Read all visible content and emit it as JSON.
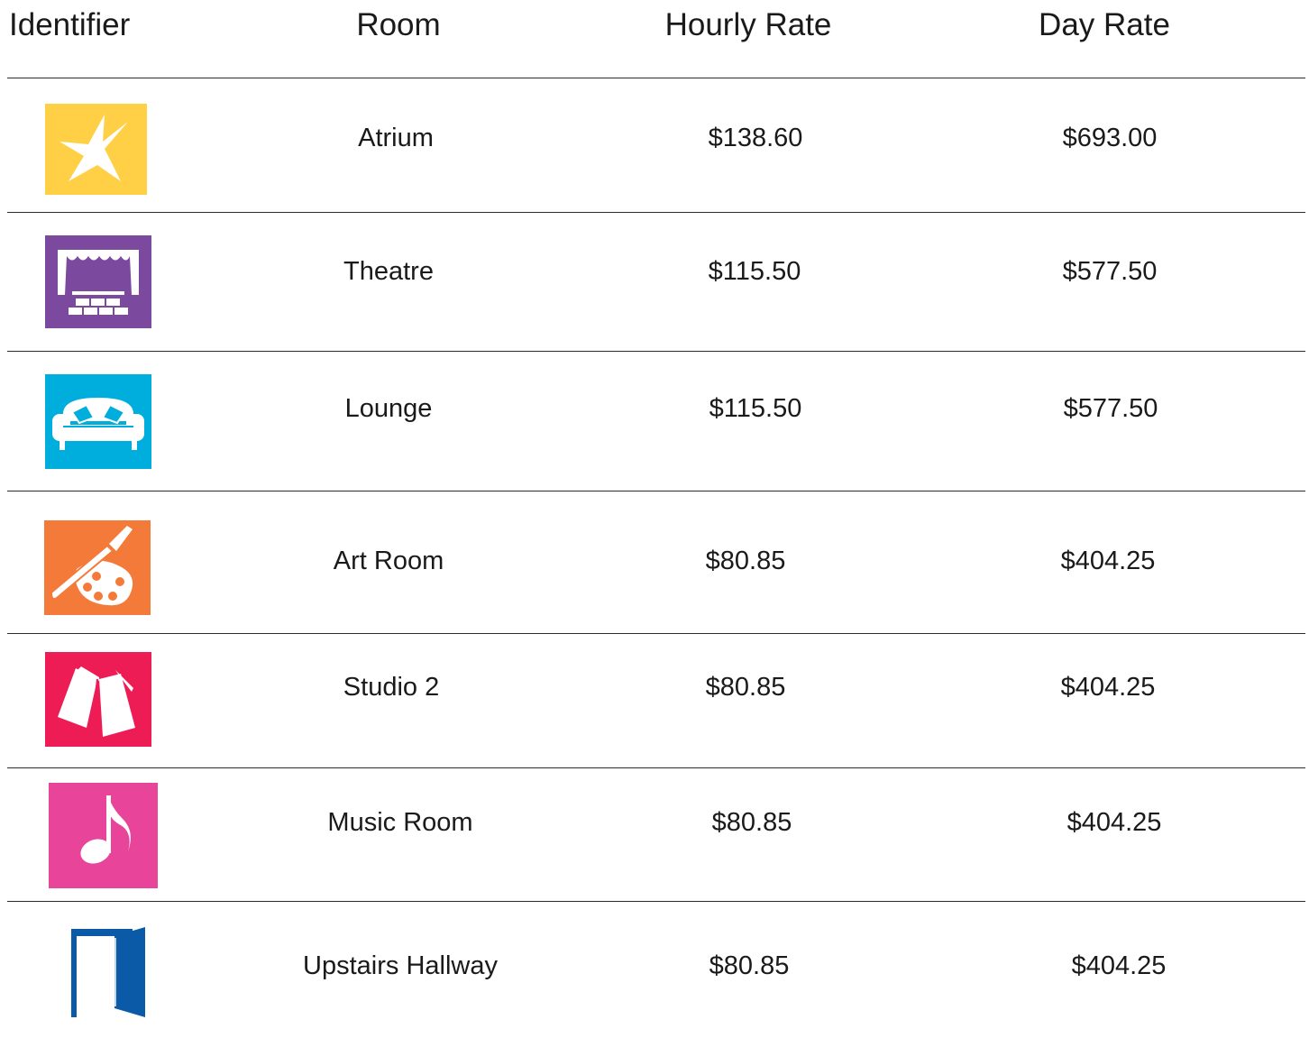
{
  "headers": {
    "identifier": "Identifier",
    "room": "Room",
    "hourly_rate": "Hourly Rate",
    "day_rate": "Day Rate"
  },
  "colors": {
    "atrium": "#ffd045",
    "theatre": "#7b4a9e",
    "lounge": "#00aede",
    "art_room": "#f47a3a",
    "studio_2": "#ee1c54",
    "music_room": "#e8449a",
    "upstairs_hallway": "#0b5aa7"
  },
  "rows": [
    {
      "icon": "star-icon",
      "room": "Atrium",
      "hourly": "$138.60",
      "day": "$693.00"
    },
    {
      "icon": "theatre-stage-icon",
      "room": "Theatre",
      "hourly": "$115.50",
      "day": "$577.50"
    },
    {
      "icon": "sofa-icon",
      "room": "Lounge",
      "hourly": "$115.50",
      "day": "$577.50"
    },
    {
      "icon": "paint-palette-icon",
      "room": "Art Room",
      "hourly": "$80.85",
      "day": "$404.25"
    },
    {
      "icon": "open-book-icon",
      "room": "Studio 2",
      "hourly": "$80.85",
      "day": "$404.25"
    },
    {
      "icon": "music-note-icon",
      "room": "Music Room",
      "hourly": "$80.85",
      "day": "$404.25"
    },
    {
      "icon": "open-door-icon",
      "room": "Upstairs Hallway",
      "hourly": "$80.85",
      "day": "$404.25"
    }
  ]
}
